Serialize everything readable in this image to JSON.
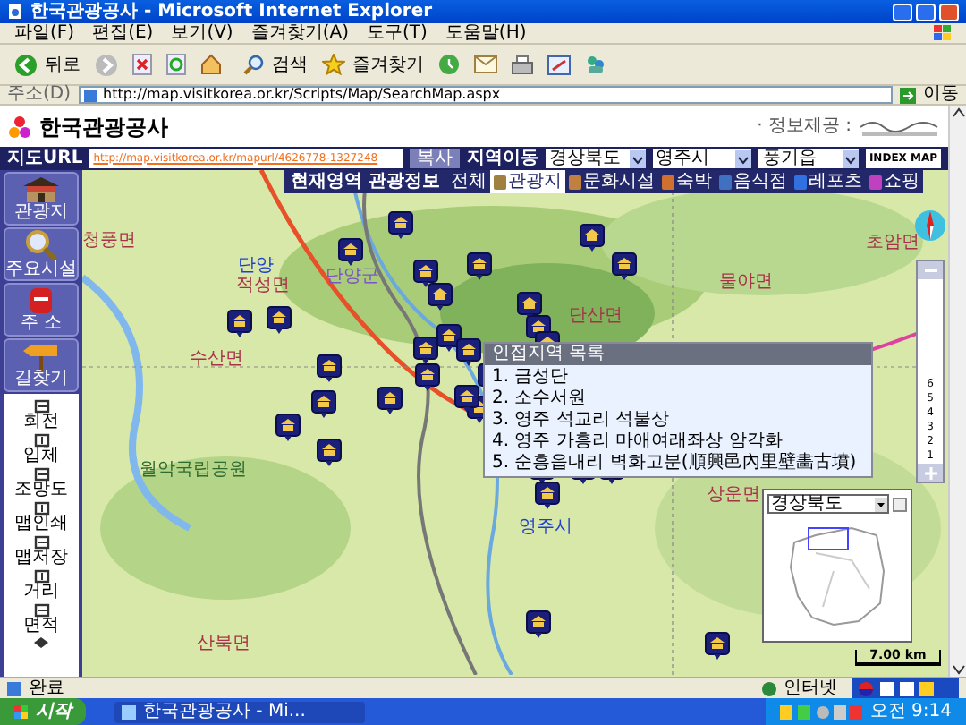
{
  "window": {
    "title": "한국관광공사 - Microsoft Internet Explorer"
  },
  "menu": [
    "파일(F)",
    "편집(E)",
    "보기(V)",
    "즐겨찾기(A)",
    "도구(T)",
    "도움말(H)"
  ],
  "toolbar": {
    "back": "뒤로",
    "search": "검색",
    "favorites": "즐겨찾기"
  },
  "address": {
    "label": "주소(D)",
    "url": "http://map.visitkorea.or.kr/Scripts/Map/SearchMap.aspx",
    "go": "이동"
  },
  "header": {
    "logo": "한국관광공사",
    "info_label": "· 정보제공 :"
  },
  "map_bar": {
    "url_label": "지도URL",
    "url": "http://map.visitkorea.or.kr/mapurl/4626778-1327248",
    "copy": "복사",
    "region_label": "지역이동",
    "selects": [
      "경상북도",
      "영주시",
      "풍기읍"
    ],
    "index_map": "INDEX MAP"
  },
  "sidebar": [
    {
      "label": "관광지",
      "kind": "gate"
    },
    {
      "label": "주요시설",
      "kind": "search"
    },
    {
      "label": "주 소",
      "kind": "mailbox"
    },
    {
      "label": "길찾기",
      "kind": "sign"
    }
  ],
  "tools": [
    "회전",
    "입체",
    "조망도",
    "맵인쇄",
    "맵저장",
    "거리",
    "면적"
  ],
  "info_tabs": {
    "title": "현재영역 관광정보",
    "tabs": [
      {
        "label": "전체",
        "selected": false
      },
      {
        "label": "관광지",
        "selected": true
      },
      {
        "label": "문화시설",
        "selected": false
      },
      {
        "label": "숙박",
        "selected": false
      },
      {
        "label": "음식점",
        "selected": false
      },
      {
        "label": "레포츠",
        "selected": false
      },
      {
        "label": "쇼핑",
        "selected": false
      }
    ]
  },
  "map_labels": [
    {
      "text": "청풍면",
      "kind": "district"
    },
    {
      "text": "단양",
      "kind": "city"
    },
    {
      "text": "적성면",
      "kind": "district"
    },
    {
      "text": "단양군",
      "kind": "county"
    },
    {
      "text": "초암면",
      "kind": "district"
    },
    {
      "text": "물야면",
      "kind": "district"
    },
    {
      "text": "수산면",
      "kind": "district"
    },
    {
      "text": "단산면",
      "kind": "district"
    },
    {
      "text": "월악국립공원",
      "kind": "park"
    },
    {
      "text": "영주시",
      "kind": "city"
    },
    {
      "text": "상운면",
      "kind": "district"
    },
    {
      "text": "산북면",
      "kind": "district"
    }
  ],
  "nearby": {
    "title": "인접지역 목록",
    "items": [
      "1. 금성단",
      "2. 소수서원",
      "3. 영주 석교리 석불상",
      "4. 영주 가흥리 마애여래좌상 암각화",
      "5. 순흥읍내리 벽화고분(順興邑內里壁畵古墳)"
    ]
  },
  "zoom": {
    "levels": [
      "6",
      "5",
      "4",
      "3",
      "2",
      "1"
    ]
  },
  "minimap": {
    "region": "경상북도"
  },
  "scale": "7.00 km",
  "status": {
    "text": "완료",
    "zone": "인터넷"
  },
  "taskbar": {
    "start": "시작",
    "window": "한국관광공사 - Mi...",
    "clock": "오전 9:14"
  }
}
